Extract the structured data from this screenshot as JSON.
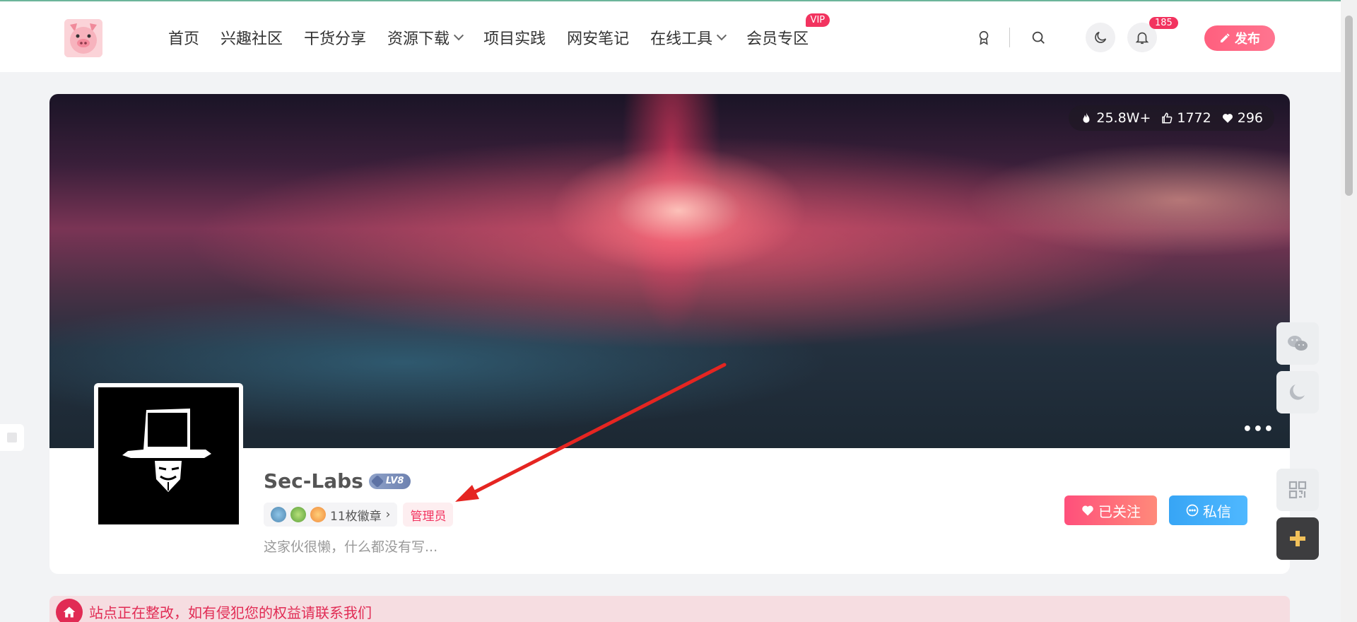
{
  "nav": {
    "items": [
      {
        "label": "首页"
      },
      {
        "label": "兴趣社区"
      },
      {
        "label": "干货分享"
      },
      {
        "label": "资源下载",
        "dropdown": true
      },
      {
        "label": "项目实践"
      },
      {
        "label": "网安笔记"
      },
      {
        "label": "在线工具",
        "dropdown": true
      },
      {
        "label": "会员专区",
        "badge": "VIP"
      }
    ]
  },
  "header": {
    "notification_count": "185",
    "publish_label": "发布",
    "icons": [
      "badge-icon",
      "search-icon",
      "moon-icon",
      "bell-icon"
    ]
  },
  "profile": {
    "stats": {
      "views": "25.8W+",
      "likes": "1772",
      "favorites": "296"
    },
    "more": "•••",
    "username": "Sec-Labs",
    "level": "LV8",
    "medals_label": "11枚徽章",
    "medals_chevron": "›",
    "role": "管理员",
    "bio": "这家伙很懒，什么都没有写...",
    "follow_label": "已关注",
    "message_label": "私信"
  },
  "notice": {
    "text": "站点正在整改，如有侵犯您的权益请联系我们"
  },
  "float_tools": [
    "wechat-icon",
    "moon-icon",
    "qrcode-icon",
    "plus-icon"
  ],
  "colors": {
    "accent": "#f2335f",
    "follow_gradient": [
      "#ff4f7b",
      "#ff8a7a"
    ],
    "message_gradient": [
      "#37a5f5",
      "#4fb8ff"
    ],
    "notice_bg": "#f6dde1",
    "annotation_arrow": "#e52521"
  }
}
